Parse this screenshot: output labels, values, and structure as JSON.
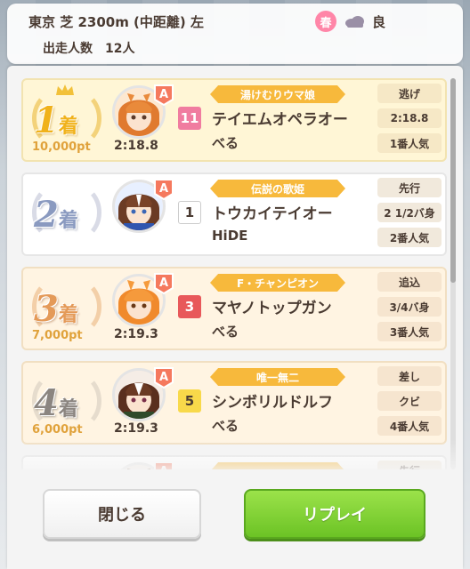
{
  "header": {
    "race_info": "東京 芝 2300m (中距離) 左",
    "season": "春",
    "weather_icon": "cloudy-icon",
    "track_condition": "良",
    "starters": "出走人数　12人"
  },
  "results": [
    {
      "place_number": "1",
      "place_suffix": "着",
      "points": "10,000pt",
      "time": "2:18.8",
      "gate": "11",
      "title": "湯けむりウマ娘",
      "horse": "テイエムオペラオー",
      "jockey": "べる",
      "strategy": "逃げ",
      "margin": "2:18.8",
      "popularity": "1番人気",
      "rank": "A",
      "style": "gold",
      "gate_color": "#f07ca0"
    },
    {
      "place_number": "2",
      "place_suffix": "着",
      "points": "",
      "time": "",
      "gate": "1",
      "title": "伝説の歌姫",
      "horse": "トウカイテイオー",
      "jockey": "HiDE",
      "strategy": "先行",
      "margin": "2 1/2バ身",
      "popularity": "2番人気",
      "rank": "A",
      "style": "silver",
      "gate_color": "#ffffff"
    },
    {
      "place_number": "3",
      "place_suffix": "着",
      "points": "7,000pt",
      "time": "2:19.3",
      "gate": "3",
      "title": "F・チャンピオン",
      "horse": "マヤノトップガン",
      "jockey": "べる",
      "strategy": "追込",
      "margin": "3/4バ身",
      "popularity": "3番人気",
      "rank": "A",
      "style": "bronze",
      "gate_color": "#e8585a"
    },
    {
      "place_number": "4",
      "place_suffix": "着",
      "points": "6,000pt",
      "time": "2:19.3",
      "gate": "5",
      "title": "唯一無二",
      "horse": "シンボリルドルフ",
      "jockey": "べる",
      "strategy": "差し",
      "margin": "クビ",
      "popularity": "4番人気",
      "rank": "A",
      "style": "plain",
      "gate_color": "#f8d94a"
    },
    {
      "place_number": "",
      "place_suffix": "",
      "points": "",
      "time": "",
      "gate": "",
      "title": "",
      "horse": "",
      "jockey": "",
      "strategy": "先行",
      "margin": "",
      "popularity": "",
      "rank": "A",
      "style": "silver",
      "gate_color": "#ffffff"
    }
  ],
  "buttons": {
    "close": "閉じる",
    "replay": "リプレイ"
  },
  "colors": {
    "text": "#4a3b32",
    "ribbon": "#f7b93c",
    "replay_green": "#6cc325",
    "season_pink": "#ff86a8"
  }
}
